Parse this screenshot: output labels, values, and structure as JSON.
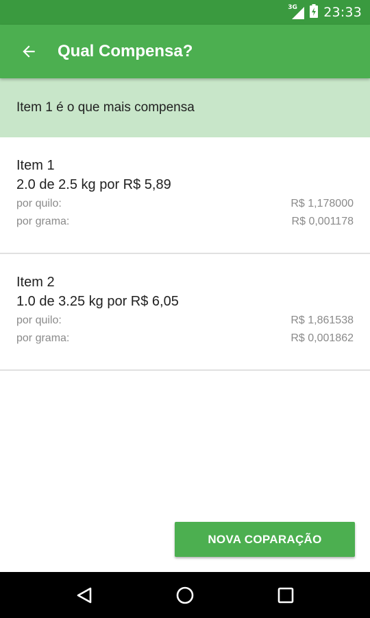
{
  "status_bar": {
    "network_label": "3G",
    "time": "23:33"
  },
  "app_bar": {
    "title": "Qual Compensa?"
  },
  "result": {
    "message": "Item 1 é o que mais compensa"
  },
  "items": [
    {
      "name": "Item 1",
      "description": "2.0 de 2.5 kg por R$ 5,89",
      "per_kilo_label": "por quilo:",
      "per_kilo_value": "R$ 1,178000",
      "per_gram_label": "por grama:",
      "per_gram_value": "R$ 0,001178"
    },
    {
      "name": "Item 2",
      "description": "1.0 de 3.25 kg por R$ 6,05",
      "per_kilo_label": "por quilo:",
      "per_kilo_value": "R$ 1,861538",
      "per_gram_label": "por grama:",
      "per_gram_value": "R$ 0,001862"
    }
  ],
  "actions": {
    "new_comparison_label": "NOVA COPARAÇÃO"
  },
  "icons": {
    "back": "arrow-back-icon",
    "nav_back": "nav-back-icon",
    "nav_home": "nav-home-icon",
    "nav_recents": "nav-recents-icon"
  },
  "colors": {
    "status_bar": "#3a9a3f",
    "primary": "#4caf50",
    "banner": "#c8e6c9"
  }
}
